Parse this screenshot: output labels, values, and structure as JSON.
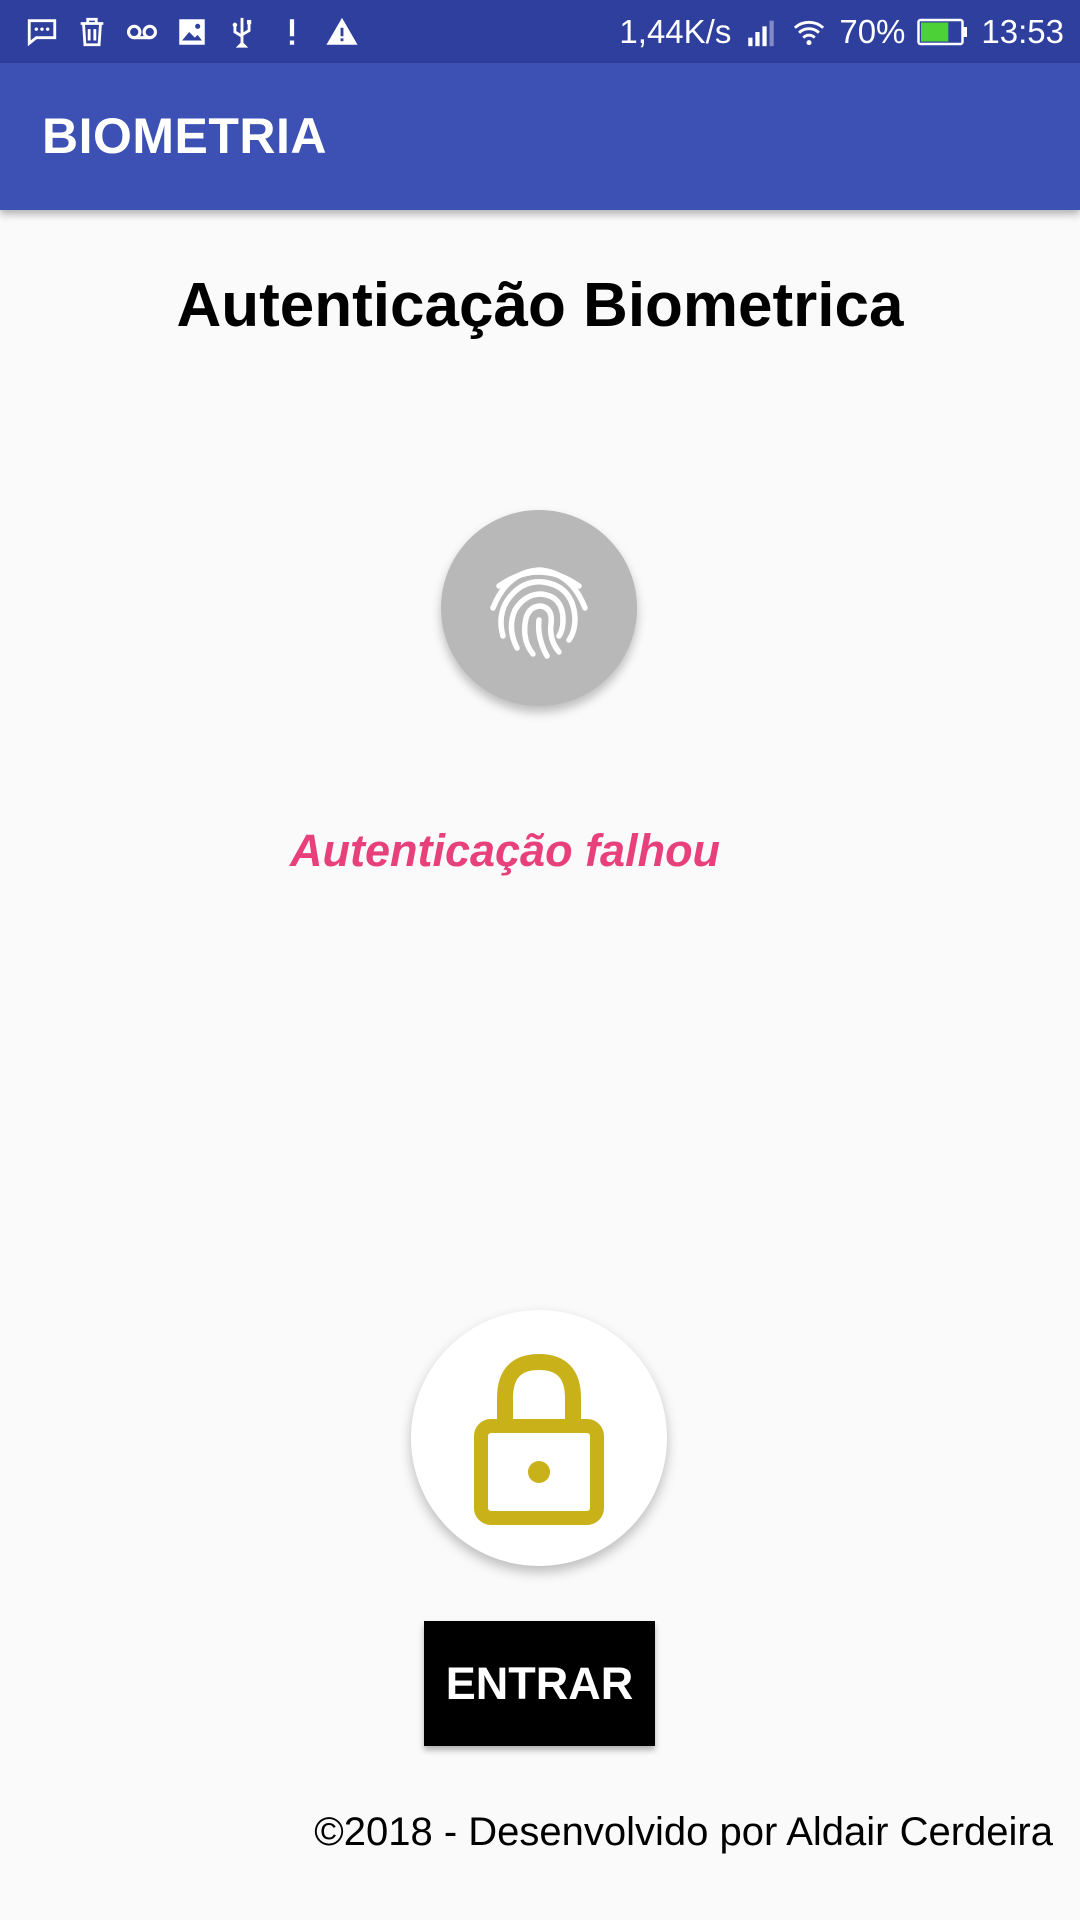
{
  "status_bar": {
    "left_icons": [
      "message-icon",
      "trash-icon",
      "voicemail-icon",
      "image-icon",
      "usb-icon",
      "alert-icon",
      "warning-icon"
    ],
    "network_speed": "1,44K/s",
    "battery_percent": "70%",
    "battery_level": 0.7,
    "time": "13:53"
  },
  "app_bar": {
    "title": "BIOMETRIA"
  },
  "main": {
    "title": "Autenticação Biometrica",
    "status_message": "Autenticação falhou",
    "enter_button": "ENTRAR"
  },
  "footer": {
    "text": "©2018 - Desenvolvido por Aldair Cerdeira"
  },
  "colors": {
    "status_bar": "#2f3f9e",
    "app_bar": "#3d51b4",
    "error_text": "#e8407a",
    "lock_icon": "#c9b11a",
    "fingerprint_bg": "#b8b8b8",
    "battery_fill": "#4cd137"
  }
}
